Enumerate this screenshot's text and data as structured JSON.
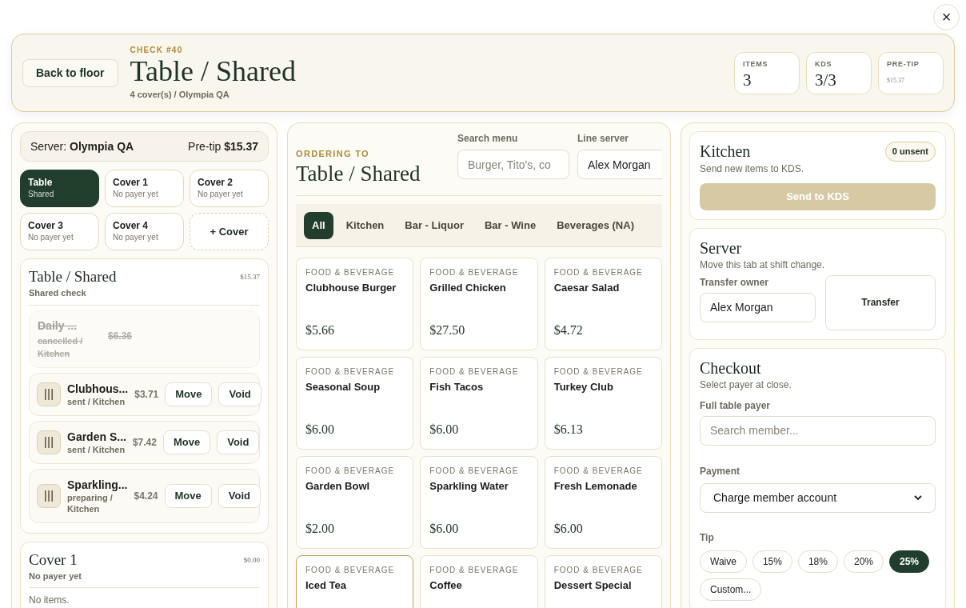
{
  "close_label": "×",
  "header": {
    "back": "Back to floor",
    "eyebrow": "CHECK #40",
    "title": "Table / Shared",
    "subtitle": "4 cover(s) / Olympia QA",
    "stats": [
      {
        "label": "ITEMS",
        "value": "3",
        "kind": "big"
      },
      {
        "label": "KDS",
        "value": "3/3",
        "kind": "big"
      },
      {
        "label": "PRE-TIP",
        "value": "$15.37",
        "kind": "small"
      }
    ]
  },
  "left": {
    "server_label": "Server:",
    "server_name": "Olympia QA",
    "pretip_label": "Pre-tip",
    "pretip_value": "$15.37",
    "covers": [
      {
        "name": "Table",
        "sub": "Shared",
        "selected": true
      },
      {
        "name": "Cover 1",
        "sub": "No payer yet",
        "selected": false
      },
      {
        "name": "Cover 2",
        "sub": "No payer yet",
        "selected": false
      },
      {
        "name": "Cover 3",
        "sub": "No payer yet",
        "selected": false
      },
      {
        "name": "Cover 4",
        "sub": "No payer yet",
        "selected": false
      }
    ],
    "add_cover": "+ Cover",
    "groups": [
      {
        "title": "Table / Shared",
        "total": "$15.37",
        "sub": "Shared check",
        "items": [
          {
            "name": "Daily ...",
            "status": "cancelled / Kitchen",
            "price": "$6.36",
            "cancelled": true
          },
          {
            "name": "Clubhous...",
            "status": "sent / Kitchen",
            "price": "$3.71",
            "cancelled": false,
            "move": "Move",
            "void": "Void"
          },
          {
            "name": "Garden S...",
            "status": "sent / Kitchen",
            "price": "$7.42",
            "cancelled": false,
            "move": "Move",
            "void": "Void"
          },
          {
            "name": "Sparkling...",
            "status": "preparing / Kitchen",
            "price": "$4.24",
            "cancelled": false,
            "move": "Move",
            "void": "Void"
          }
        ]
      },
      {
        "title": "Cover 1",
        "total": "$0.00",
        "sub": "No payer yet",
        "empty": "No items."
      }
    ]
  },
  "menu": {
    "eyebrow": "ORDERING TO",
    "title": "Table / Shared",
    "search_label": "Search menu",
    "search_placeholder": "Burger, Tito's, co",
    "server_label": "Line server",
    "server_value": "Alex Morgan",
    "categories": [
      {
        "label": "All",
        "selected": true
      },
      {
        "label": "Kitchen",
        "selected": false
      },
      {
        "label": "Bar - Liquor",
        "selected": false
      },
      {
        "label": "Bar - Wine",
        "selected": false
      },
      {
        "label": "Beverages (NA)",
        "selected": false
      }
    ],
    "items": [
      {
        "tag": "FOOD & BEVERAGE",
        "name": "Clubhouse Burger",
        "price": "$5.66",
        "selected": false
      },
      {
        "tag": "FOOD & BEVERAGE",
        "name": "Grilled Chicken",
        "price": "$27.50",
        "selected": false
      },
      {
        "tag": "FOOD & BEVERAGE",
        "name": "Caesar Salad",
        "price": "$4.72",
        "selected": false
      },
      {
        "tag": "FOOD & BEVERAGE",
        "name": "Seasonal Soup",
        "price": "$6.00",
        "selected": false
      },
      {
        "tag": "FOOD & BEVERAGE",
        "name": "Fish Tacos",
        "price": "$6.00",
        "selected": false
      },
      {
        "tag": "FOOD & BEVERAGE",
        "name": "Turkey Club",
        "price": "$6.13",
        "selected": false
      },
      {
        "tag": "FOOD & BEVERAGE",
        "name": "Garden Bowl",
        "price": "$2.00",
        "selected": false
      },
      {
        "tag": "FOOD & BEVERAGE",
        "name": "Sparkling Water",
        "price": "$6.00",
        "selected": false
      },
      {
        "tag": "FOOD & BEVERAGE",
        "name": "Fresh Lemonade",
        "price": "$6.00",
        "selected": false
      },
      {
        "tag": "FOOD & BEVERAGE",
        "name": "Iced Tea",
        "selected": true
      },
      {
        "tag": "FOOD & BEVERAGE",
        "name": "Coffee",
        "selected": false
      },
      {
        "tag": "FOOD & BEVERAGE",
        "name": "Dessert Special",
        "selected": false
      }
    ]
  },
  "kitchen": {
    "title": "Kitchen",
    "badge": "0 unsent",
    "sub": "Send new items to KDS.",
    "button": "Send to KDS",
    "disabled": true
  },
  "server": {
    "title": "Server",
    "sub": "Move this tab at shift change.",
    "label": "Transfer owner",
    "value": "Alex Morgan",
    "button": "Transfer"
  },
  "checkout": {
    "title": "Checkout",
    "sub": "Select payer at close.",
    "payer_label": "Full table payer",
    "payer_placeholder": "Search member...",
    "payment_label": "Payment",
    "payment_value": "Charge member account",
    "tip_label": "Tip",
    "tips": [
      {
        "label": "Waive",
        "selected": false
      },
      {
        "label": "15%",
        "selected": false
      },
      {
        "label": "18%",
        "selected": false
      },
      {
        "label": "20%",
        "selected": false
      },
      {
        "label": "25%",
        "selected": true
      },
      {
        "label": "Custom...",
        "selected": false
      }
    ]
  }
}
